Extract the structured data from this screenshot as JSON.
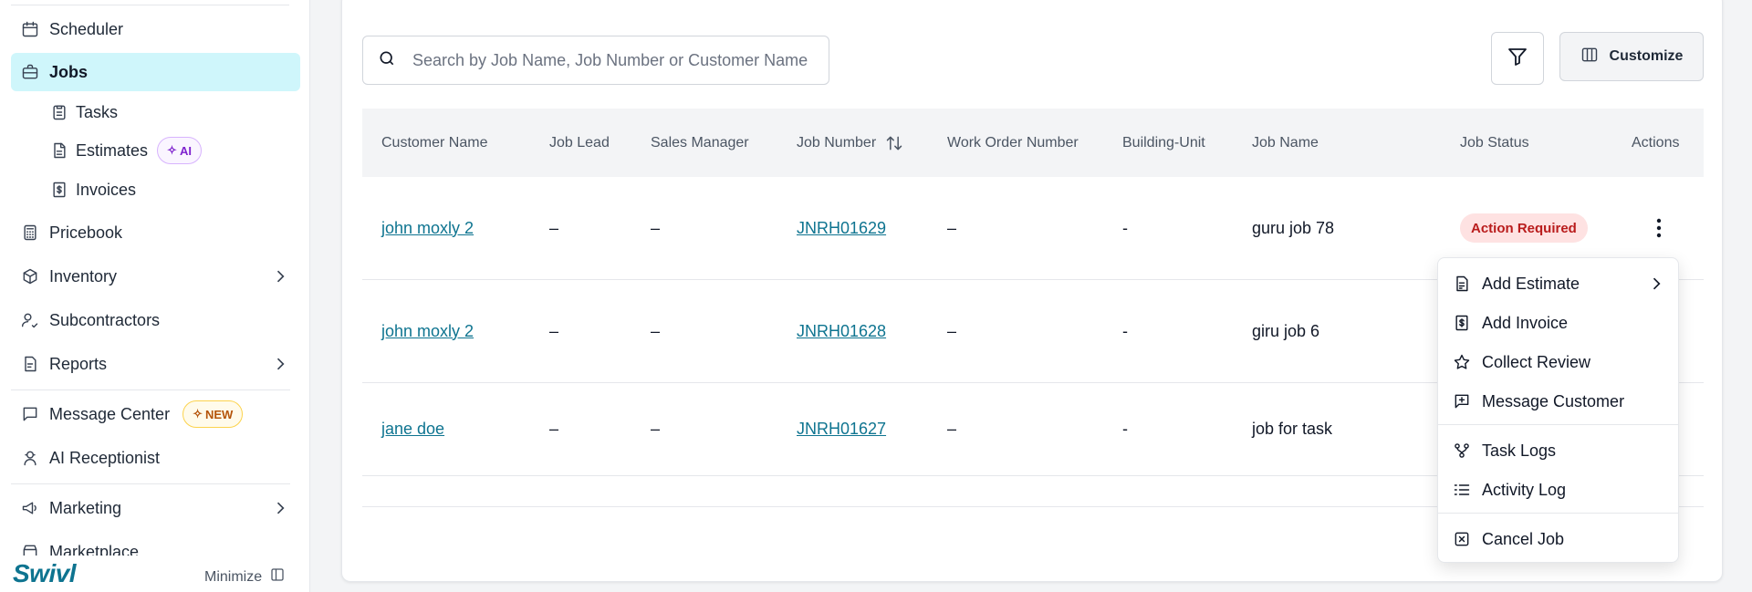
{
  "sidebar": {
    "items": [
      {
        "label": "Scheduler",
        "icon": "calendar-icon"
      },
      {
        "label": "Jobs",
        "icon": "briefcase-icon",
        "active": true
      },
      {
        "label": "Tasks",
        "icon": "clipboard-icon"
      },
      {
        "label": "Estimates",
        "icon": "document-icon",
        "badge": "AI"
      },
      {
        "label": "Invoices",
        "icon": "invoice-icon"
      },
      {
        "label": "Pricebook",
        "icon": "calculator-icon"
      },
      {
        "label": "Inventory",
        "icon": "box-icon"
      },
      {
        "label": "Subcontractors",
        "icon": "users-icon"
      },
      {
        "label": "Reports",
        "icon": "report-icon"
      },
      {
        "label": "Message Center",
        "icon": "message-icon",
        "badge": "NEW"
      },
      {
        "label": "AI Receptionist",
        "icon": "receptionist-icon"
      },
      {
        "label": "Marketing",
        "icon": "megaphone-icon"
      },
      {
        "label": "Marketplace",
        "icon": "store-icon"
      }
    ],
    "logo": "Swivl",
    "minimize_label": "Minimize"
  },
  "toolbar": {
    "search_placeholder": "Search by Job Name, Job Number or Customer Name",
    "customize_label": "Customize"
  },
  "table": {
    "columns": [
      "Customer Name",
      "Job Lead",
      "Sales Manager",
      "Job Number",
      "Work Order Number",
      "Building-Unit",
      "Job Name",
      "Job Status",
      "Actions"
    ],
    "rows": [
      {
        "customer": "john moxly 2",
        "job_lead": "–",
        "sales_manager": "–",
        "job_number": "JNRH01629",
        "work_order": "–",
        "building_unit": "-",
        "job_name": "guru job 78",
        "status": "Action Required"
      },
      {
        "customer": "john moxly 2",
        "job_lead": "–",
        "sales_manager": "–",
        "job_number": "JNRH01628",
        "work_order": "–",
        "building_unit": "-",
        "job_name": "giru job 6",
        "status": ""
      },
      {
        "customer": "jane doe",
        "job_lead": "–",
        "sales_manager": "–",
        "job_number": "JNRH01627",
        "work_order": "–",
        "building_unit": "-",
        "job_name": "job for task",
        "status": ""
      }
    ]
  },
  "menu": {
    "items": [
      {
        "label": "Add Estimate",
        "icon": "estimate-icon"
      },
      {
        "label": "Add Invoice",
        "icon": "invoice-icon"
      },
      {
        "label": "Collect Review",
        "icon": "star-icon"
      },
      {
        "label": "Message Customer",
        "icon": "message-plus-icon"
      },
      {
        "label": "Task Logs",
        "icon": "flow-icon"
      },
      {
        "label": "Activity Log",
        "icon": "list-icon"
      },
      {
        "label": "Cancel Job",
        "icon": "x-square-icon"
      }
    ]
  },
  "colors": {
    "accent": "#0e7490",
    "active_bg": "#cff6fb",
    "status_bg": "#fee2e2",
    "status_text": "#b91c1c"
  }
}
